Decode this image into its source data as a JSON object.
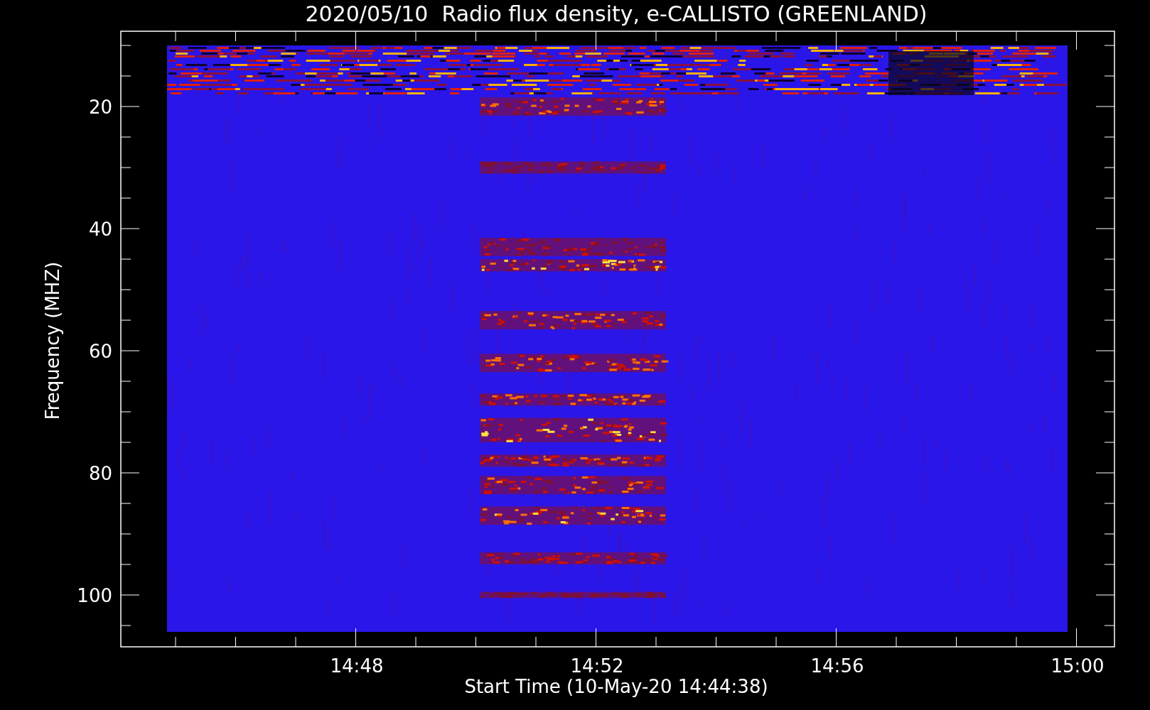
{
  "title": "2020/05/10  Radio flux density, e-CALLISTO (GREENLAND)",
  "y_axis": {
    "label": "Frequency (MHZ)",
    "ticks": [
      "20",
      "40",
      "60",
      "80",
      "100"
    ]
  },
  "x_axis": {
    "label": "Start Time (10-May-20 14:44:38)",
    "ticks": [
      "14:48",
      "14:52",
      "14:56",
      "15:00"
    ]
  }
}
